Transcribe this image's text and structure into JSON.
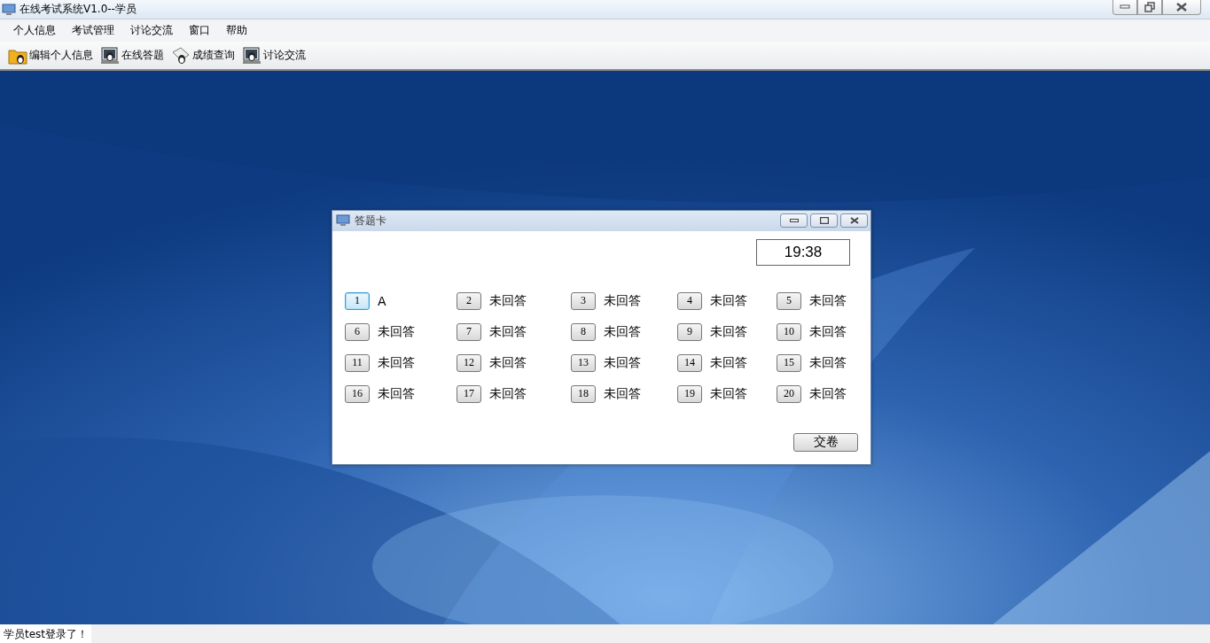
{
  "window": {
    "title": "在线考试系统V1.0--学员"
  },
  "menu": [
    "个人信息",
    "考试管理",
    "讨论交流",
    "窗口",
    "帮助"
  ],
  "toolbar": [
    {
      "kind": "folder",
      "label": "编辑个人信息"
    },
    {
      "kind": "computer",
      "label": "在线答题"
    },
    {
      "kind": "paper",
      "label": "成绩查询"
    },
    {
      "kind": "computer",
      "label": "讨论交流"
    }
  ],
  "dialog": {
    "title": "答题卡",
    "timer": "19:38",
    "submit": "交卷",
    "questions": [
      {
        "number": "1",
        "answer": "A",
        "selected": true
      },
      {
        "number": "2",
        "answer": "未回答",
        "selected": false
      },
      {
        "number": "3",
        "answer": "未回答",
        "selected": false
      },
      {
        "number": "4",
        "answer": "未回答",
        "selected": false
      },
      {
        "number": "5",
        "answer": "未回答",
        "selected": false
      },
      {
        "number": "6",
        "answer": "未回答",
        "selected": false
      },
      {
        "number": "7",
        "answer": "未回答",
        "selected": false
      },
      {
        "number": "8",
        "answer": "未回答",
        "selected": false
      },
      {
        "number": "9",
        "answer": "未回答",
        "selected": false
      },
      {
        "number": "10",
        "answer": "未回答",
        "selected": false
      },
      {
        "number": "11",
        "answer": "未回答",
        "selected": false
      },
      {
        "number": "12",
        "answer": "未回答",
        "selected": false
      },
      {
        "number": "13",
        "answer": "未回答",
        "selected": false
      },
      {
        "number": "14",
        "answer": "未回答",
        "selected": false
      },
      {
        "number": "15",
        "answer": "未回答",
        "selected": false
      },
      {
        "number": "16",
        "answer": "未回答",
        "selected": false
      },
      {
        "number": "17",
        "answer": "未回答",
        "selected": false
      },
      {
        "number": "18",
        "answer": "未回答",
        "selected": false
      },
      {
        "number": "19",
        "answer": "未回答",
        "selected": false
      },
      {
        "number": "20",
        "answer": "未回答",
        "selected": false
      }
    ]
  },
  "status_bar": "学员test登录了！"
}
